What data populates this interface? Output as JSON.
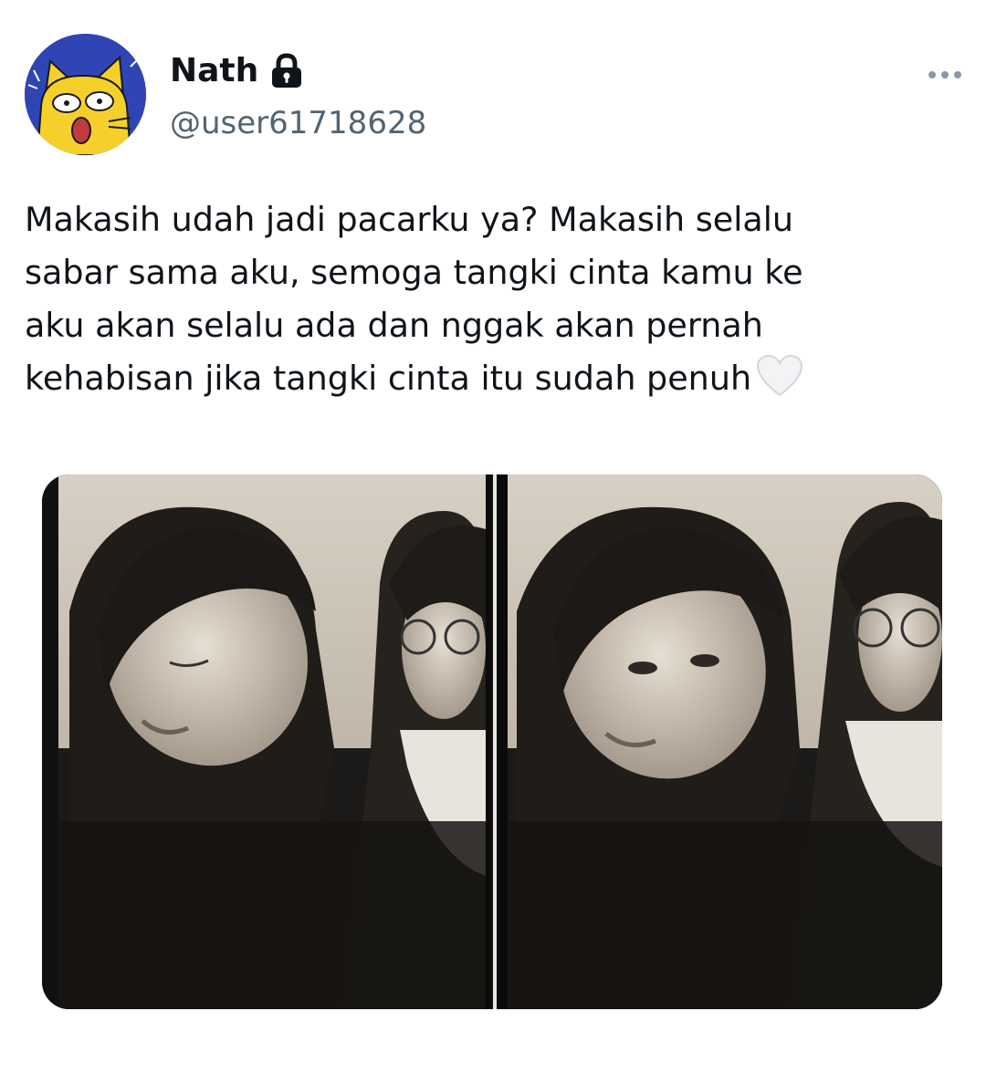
{
  "tweet": {
    "author": {
      "display_name": "Nath",
      "handle": "@user61718628",
      "avatar_icon": "cat-cartoon-avatar",
      "verified_protected_icon": "lock-icon"
    },
    "more_icon": "more-horizontal-icon",
    "text_lines": [
      "Makasih udah jadi pacarku ya? Makasih selalu",
      "sabar sama aku, semoga tangki cinta kamu ke",
      "aku akan selalu ada dan nggak akan pernah",
      "kehabisan jika tangki cinta itu sudah penuh"
    ],
    "emoji": "white-heart-emoji",
    "media": {
      "type": "photo",
      "description_icon": "photo-booth-strip"
    }
  },
  "colors": {
    "text_primary": "#0f1419",
    "text_secondary": "#536471",
    "avatar_background": "#2f45b4",
    "cat_yellow": "#f5d02a"
  }
}
